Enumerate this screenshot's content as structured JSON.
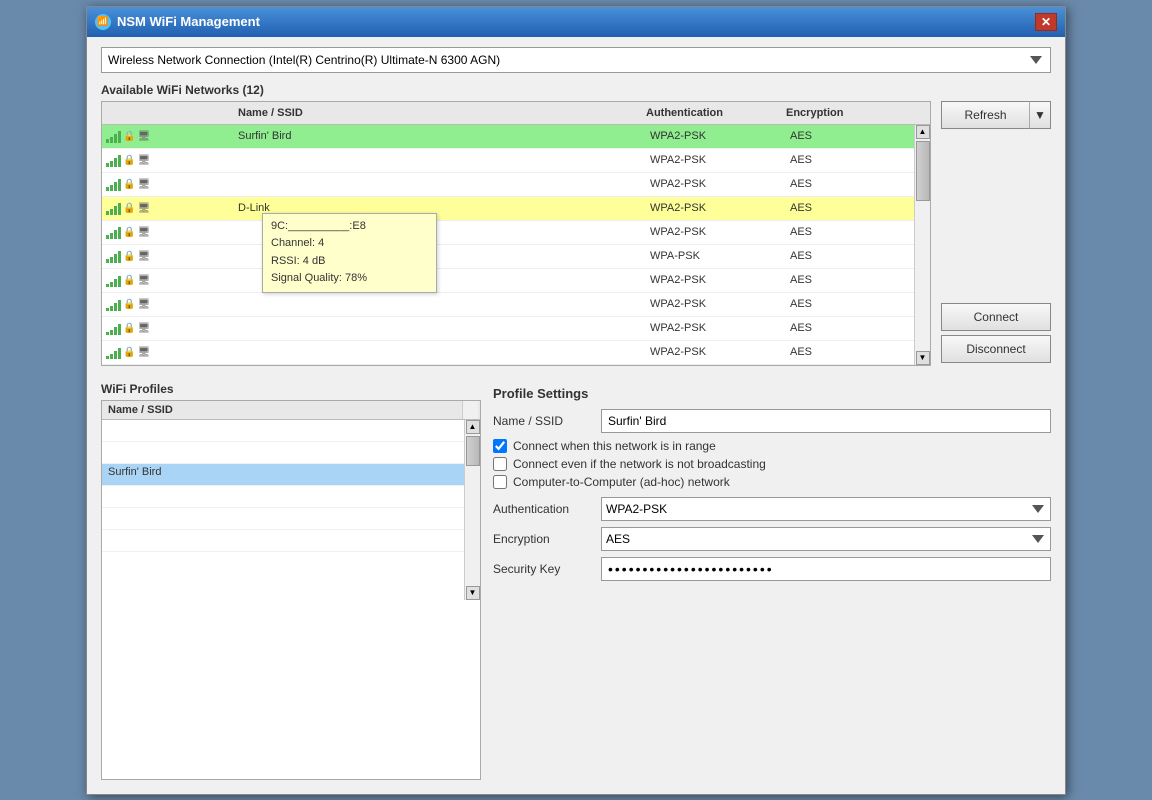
{
  "window": {
    "title": "NSM WiFi Management",
    "close_label": "✕"
  },
  "adapter": {
    "label": "Wireless Network Connection (Intel(R) Centrino(R) Ultimate-N 6300 AGN)",
    "dropdown_arrow": "▼"
  },
  "available_networks": {
    "section_label": "Available WiFi Networks (12)",
    "columns": [
      "Name / SSID",
      "Authentication",
      "Encryption"
    ],
    "rows": [
      {
        "name": "Surfin' Bird",
        "auth": "WPA2-PSK",
        "enc": "AES",
        "state": "selected"
      },
      {
        "name": "",
        "auth": "WPA2-PSK",
        "enc": "AES",
        "state": "normal"
      },
      {
        "name": "",
        "auth": "WPA2-PSK",
        "enc": "AES",
        "state": "normal"
      },
      {
        "name": "D-Link",
        "auth": "WPA2-PSK",
        "enc": "AES",
        "state": "highlighted"
      },
      {
        "name": "",
        "auth": "WPA2-PSK",
        "enc": "AES",
        "state": "normal"
      },
      {
        "name": "",
        "auth": "WPA-PSK",
        "enc": "AES",
        "state": "normal"
      },
      {
        "name": "",
        "auth": "WPA2-PSK",
        "enc": "AES",
        "state": "normal"
      },
      {
        "name": "",
        "auth": "WPA2-PSK",
        "enc": "AES",
        "state": "normal"
      },
      {
        "name": "",
        "auth": "WPA2-PSK",
        "enc": "AES",
        "state": "normal"
      },
      {
        "name": "",
        "auth": "WPA2-PSK",
        "enc": "AES",
        "state": "normal"
      }
    ]
  },
  "tooltip": {
    "mac": "9C:__________:E8",
    "channel": "Channel: 4",
    "rssi": "RSSI: 4 dB",
    "signal": "Signal Quality: 78%"
  },
  "buttons": {
    "refresh": "Refresh",
    "refresh_arrow": "▼",
    "connect": "Connect",
    "disconnect": "Disconnect"
  },
  "wifi_profiles": {
    "section_label": "WiFi Profiles",
    "column_label": "Name / SSID",
    "profiles": [
      {
        "name": "",
        "state": "normal"
      },
      {
        "name": "",
        "state": "normal"
      },
      {
        "name": "Surfin' Bird",
        "state": "selected"
      },
      {
        "name": "",
        "state": "normal"
      },
      {
        "name": "",
        "state": "normal"
      },
      {
        "name": "",
        "state": "normal"
      }
    ]
  },
  "profile_settings": {
    "title": "Profile Settings",
    "name_label": "Name / SSID",
    "name_value": "Surfin' Bird",
    "checkboxes": [
      {
        "label": "Connect when this network is in range",
        "checked": true
      },
      {
        "label": "Connect even if the network is not broadcasting",
        "checked": false
      },
      {
        "label": "Computer-to-Computer (ad-hoc) network",
        "checked": false
      }
    ],
    "auth_label": "Authentication",
    "auth_value": "WPA2-PSK",
    "enc_label": "Encryption",
    "enc_value": "AES",
    "key_label": "Security Key",
    "key_value": "************************"
  }
}
